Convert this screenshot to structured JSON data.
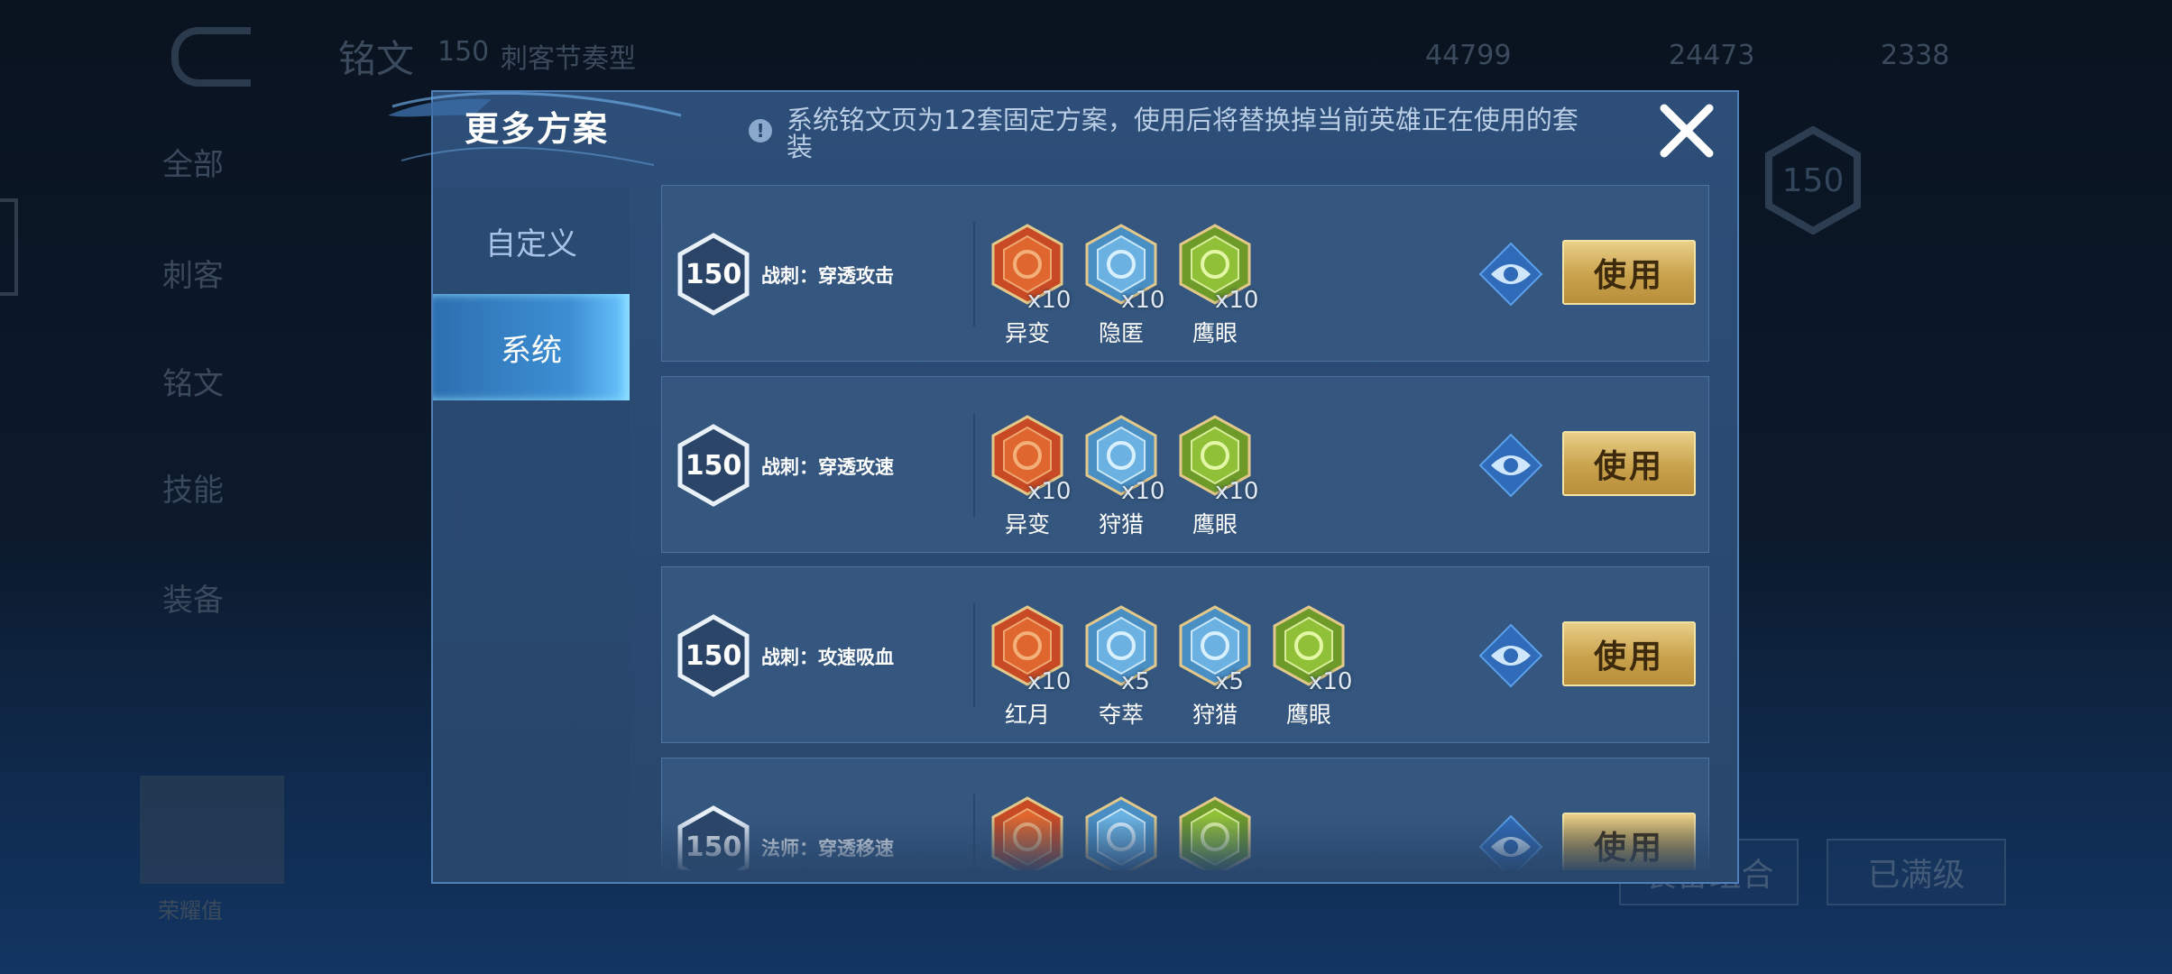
{
  "background": {
    "title": "铭文",
    "title_level": "150",
    "title_scheme": "刺客节奏型",
    "currency_1": "44799",
    "currency_2": "24473",
    "currency_3": "2338",
    "sidebar": [
      "全部",
      "刺客",
      "铭文",
      "技能",
      "装备"
    ],
    "card_label": "荣耀值",
    "btn_right": "已满级",
    "btn_mid": "装备组合",
    "big_level": "150"
  },
  "modal": {
    "title": "更多方案",
    "notice": "系统铭文页为12套固定方案，使用后将替换掉当前英雄正在使用的套装",
    "tabs": [
      {
        "label": "自定义"
      },
      {
        "label": "系统"
      }
    ],
    "active_tab": "系统",
    "use_label": "使用",
    "colors": {
      "modal_bg": "#2c4e78",
      "row_bg": "#35577f",
      "active_tab": "#3d8fd4",
      "use_button": "#c9a24c"
    },
    "plans": [
      {
        "level": "150",
        "name": "战刺：穿透攻击",
        "runes": [
          {
            "name": "异变",
            "count": "x10",
            "color": "red",
            "icon": "mutation-rune-icon"
          },
          {
            "name": "隐匿",
            "count": "x10",
            "color": "blue",
            "icon": "stealth-rune-icon"
          },
          {
            "name": "鹰眼",
            "count": "x10",
            "color": "green",
            "icon": "hawkeye-rune-icon"
          }
        ]
      },
      {
        "level": "150",
        "name": "战刺：穿透攻速",
        "runes": [
          {
            "name": "异变",
            "count": "x10",
            "color": "red",
            "icon": "mutation-rune-icon"
          },
          {
            "name": "狩猎",
            "count": "x10",
            "color": "blue",
            "icon": "hunting-rune-icon"
          },
          {
            "name": "鹰眼",
            "count": "x10",
            "color": "green",
            "icon": "hawkeye-rune-icon"
          }
        ]
      },
      {
        "level": "150",
        "name": "战刺：攻速吸血",
        "runes": [
          {
            "name": "红月",
            "count": "x10",
            "color": "red",
            "icon": "red-moon-rune-icon"
          },
          {
            "name": "夺萃",
            "count": "x5",
            "color": "blue",
            "icon": "plunder-rune-icon"
          },
          {
            "name": "狩猎",
            "count": "x5",
            "color": "blue",
            "icon": "hunting-rune-icon"
          },
          {
            "name": "鹰眼",
            "count": "x10",
            "color": "green",
            "icon": "hawkeye-rune-icon"
          }
        ]
      },
      {
        "level": "150",
        "name": "法师：穿透移速",
        "runes": [
          {
            "name": "",
            "count": "",
            "color": "red",
            "icon": "red-rune-icon"
          },
          {
            "name": "",
            "count": "",
            "color": "blue",
            "icon": "blue-rune-icon"
          },
          {
            "name": "",
            "count": "",
            "color": "green",
            "icon": "green-rune-icon"
          }
        ]
      }
    ]
  }
}
